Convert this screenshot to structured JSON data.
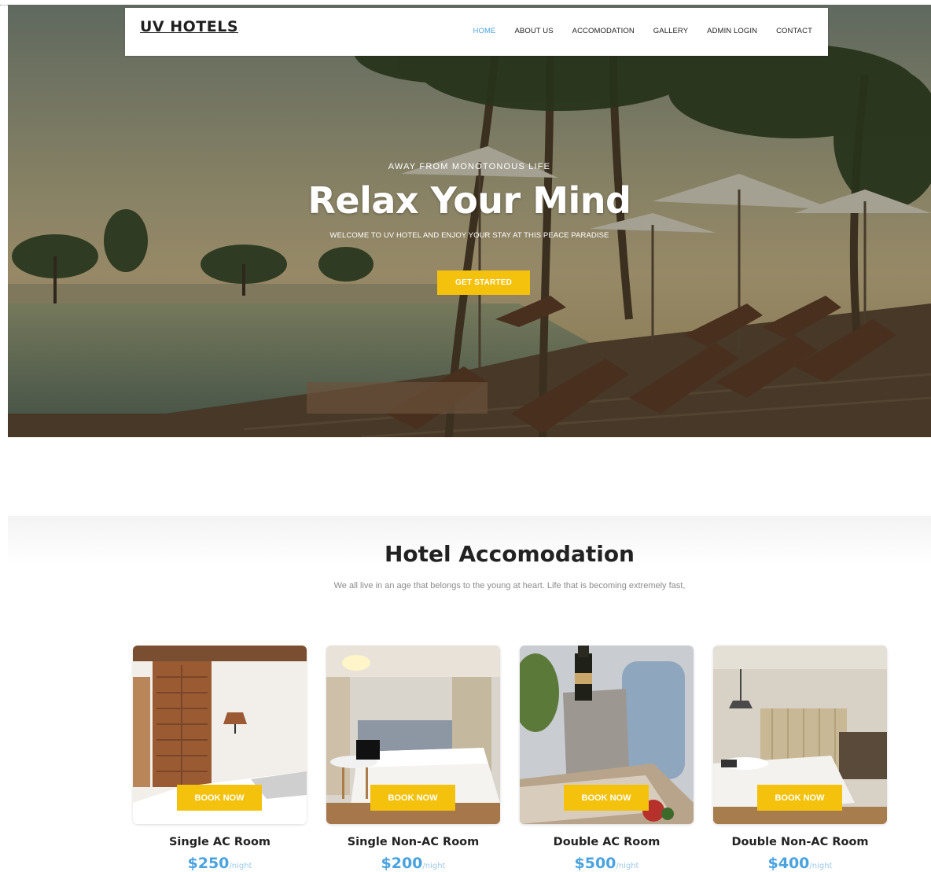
{
  "brand": {
    "logo": "UV HOTELS"
  },
  "nav": {
    "items": [
      {
        "label": "HOME",
        "active": true
      },
      {
        "label": "ABOUT US"
      },
      {
        "label": "ACCOMODATION"
      },
      {
        "label": "GALLERY"
      },
      {
        "label": "ADMIN LOGIN"
      },
      {
        "label": "CONTACT"
      }
    ]
  },
  "hero": {
    "kicker": "AWAY FROM MONOTONOUS LIFE",
    "title": "Relax Your Mind",
    "subtitle": "WELCOME TO UV HOTEL AND ENJOY YOUR STAY AT THIS PEACE PARADISE",
    "cta": "GET STARTED",
    "image": "resort-pool-with-lounge-chairs-and-palm-trees"
  },
  "accommodation": {
    "title": "Hotel Accomodation",
    "subtitle": "We all live in an age that belongs to the young at heart. Life that is becoming extremely fast,",
    "rooms": [
      {
        "name": "Single AC Room",
        "price": "$250",
        "per": "/night",
        "button": "BOOK NOW",
        "image": "bedroom-with-wooden-shutters"
      },
      {
        "name": "Single Non-AC Room",
        "price": "$200",
        "per": "/night",
        "button": "BOOK NOW",
        "image": "bedroom-with-laptop-on-table"
      },
      {
        "name": "Double AC Room",
        "price": "$500",
        "per": "/night",
        "button": "BOOK NOW",
        "image": "champagne-bucket-on-tray"
      },
      {
        "name": "Double Non-AC Room",
        "price": "$400",
        "per": "/night",
        "button": "BOOK NOW",
        "image": "bedroom-with-pendant-lamp"
      }
    ]
  },
  "colors": {
    "accent_yellow": "#f4c20d",
    "link_blue": "#4aa3df",
    "text_dark": "#222222"
  }
}
